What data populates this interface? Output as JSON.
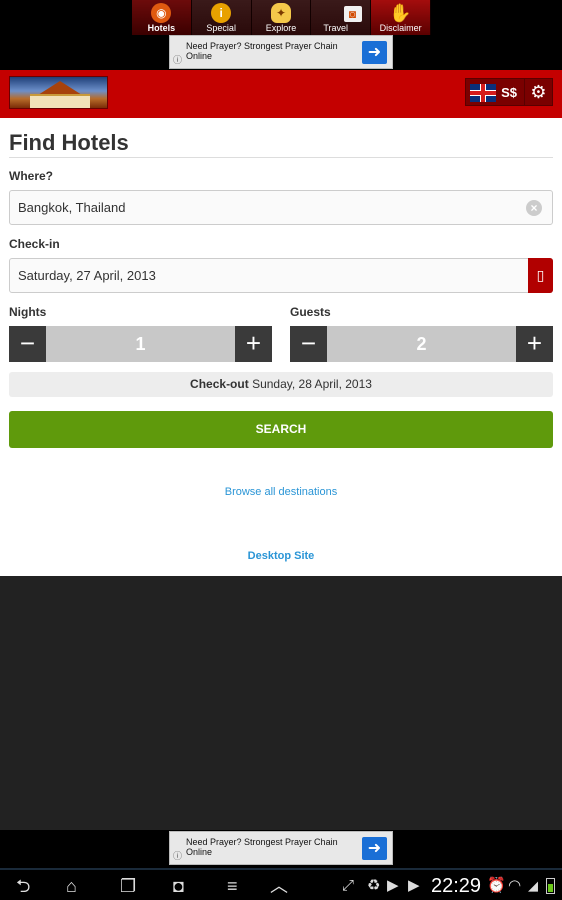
{
  "nav": {
    "tabs": [
      {
        "label": "Hotels",
        "icon": "globe-icon"
      },
      {
        "label": "Special",
        "icon": "info-icon"
      },
      {
        "label": "Explore",
        "icon": "lightbulb-icon"
      },
      {
        "label": "Travel",
        "icon": "camera-icon"
      },
      {
        "label": "Disclaimer",
        "icon": "hand-icon"
      }
    ]
  },
  "ad": {
    "text": "Need Prayer? Strongest Prayer Chain Online",
    "info": "ⓘ",
    "arrow": "➜"
  },
  "header": {
    "currency": "S$",
    "gear": "⚙"
  },
  "form": {
    "title": "Find Hotels",
    "where_label": "Where?",
    "where_value": "Bangkok, Thailand",
    "clear": "×",
    "checkin_label": "Check-in",
    "checkin_value": "Saturday, 27 April, 2013",
    "nights_label": "Nights",
    "nights_value": "1",
    "guests_label": "Guests",
    "guests_value": "2",
    "minus": "−",
    "plus": "+",
    "checkout_label": "Check-out",
    "checkout_value": "Sunday, 28 April, 2013",
    "search": "SEARCH",
    "browse": "Browse all destinations",
    "desktop": "Desktop Site"
  },
  "system": {
    "time": "22:29"
  },
  "colors": {
    "brand_red": "#c40000",
    "search_green": "#5f9a0c",
    "link_blue": "#2a95d6"
  }
}
